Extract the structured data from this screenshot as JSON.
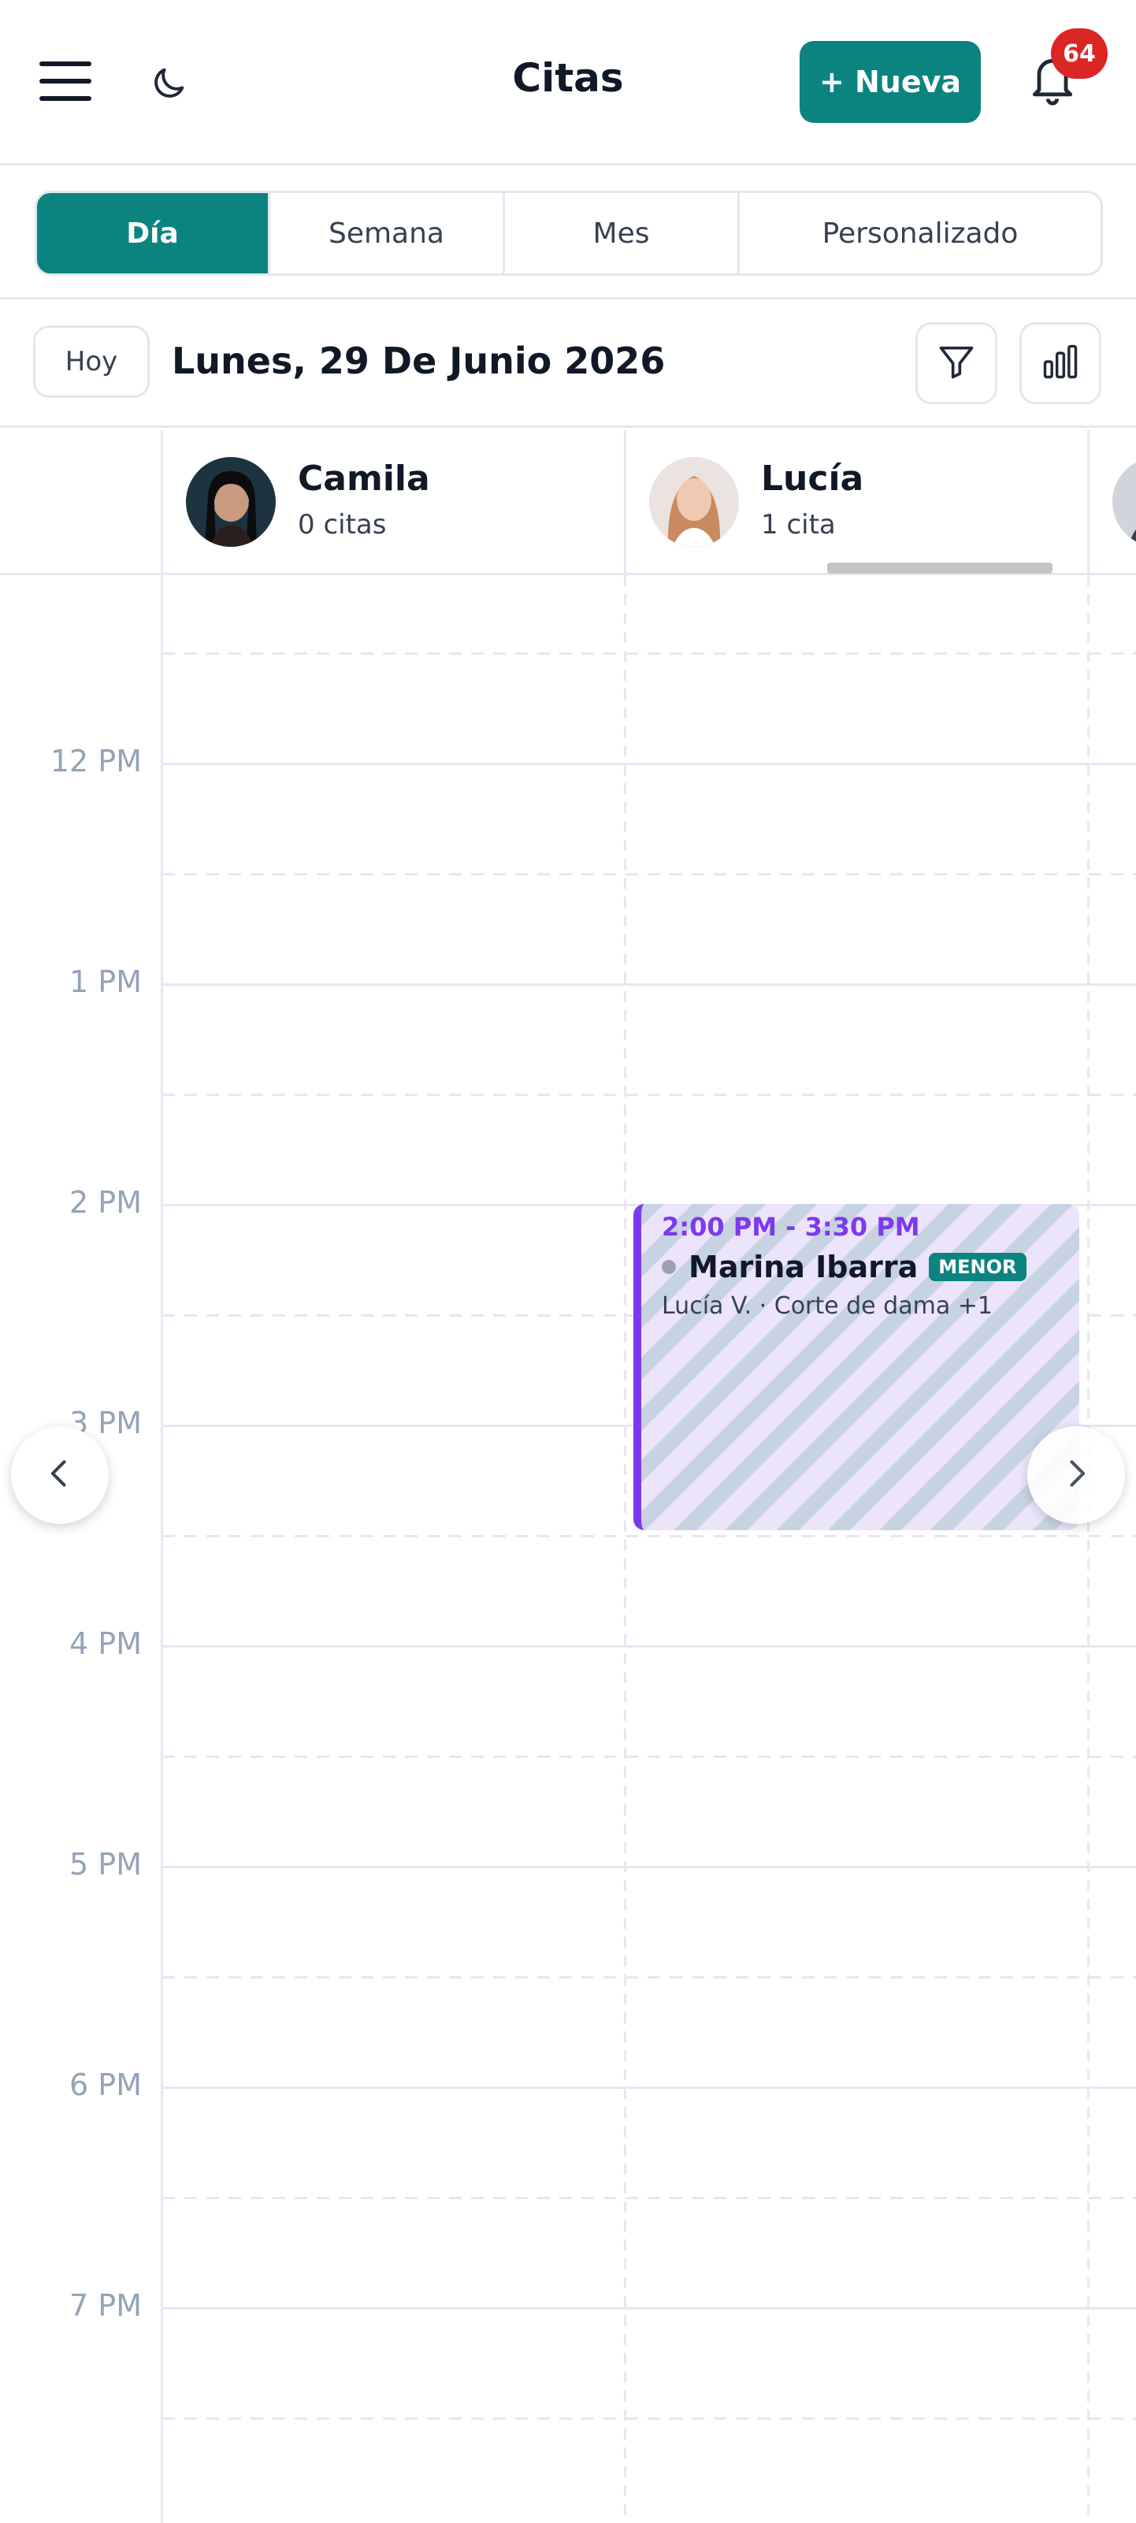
{
  "header": {
    "title": "Citas",
    "new_button": "+ Nueva",
    "notifications_count": "64",
    "icons": [
      "hamburger-menu-icon",
      "moon-icon",
      "bell-icon"
    ]
  },
  "tabs": [
    {
      "label": "Día",
      "active": true
    },
    {
      "label": "Semana",
      "active": false
    },
    {
      "label": "Mes",
      "active": false
    },
    {
      "label": "Personalizado",
      "active": false
    }
  ],
  "date_bar": {
    "today_button": "Hoy",
    "date": "Lunes, 29 De Junio 2026",
    "icons": [
      "filter-icon",
      "bar-chart-icon"
    ]
  },
  "staff": [
    {
      "name": "Camila",
      "count": "0 citas"
    },
    {
      "name": "Lucía",
      "count": "1 cita"
    }
  ],
  "time_labels": [
    "12 PM",
    "1 PM",
    "2 PM",
    "3 PM",
    "4 PM",
    "5 PM",
    "6 PM",
    "7 PM"
  ],
  "appointment": {
    "time": "2:00 PM - 3:30 PM",
    "client": "Marina Ibarra",
    "tag": "MENOR",
    "details": "Lucía V. · Corte de dama +1",
    "accent_color": "#7c3aed"
  },
  "colors": {
    "primary": "#0b8480",
    "badge": "#dc2626",
    "grid_line": "#e5e7f2"
  }
}
